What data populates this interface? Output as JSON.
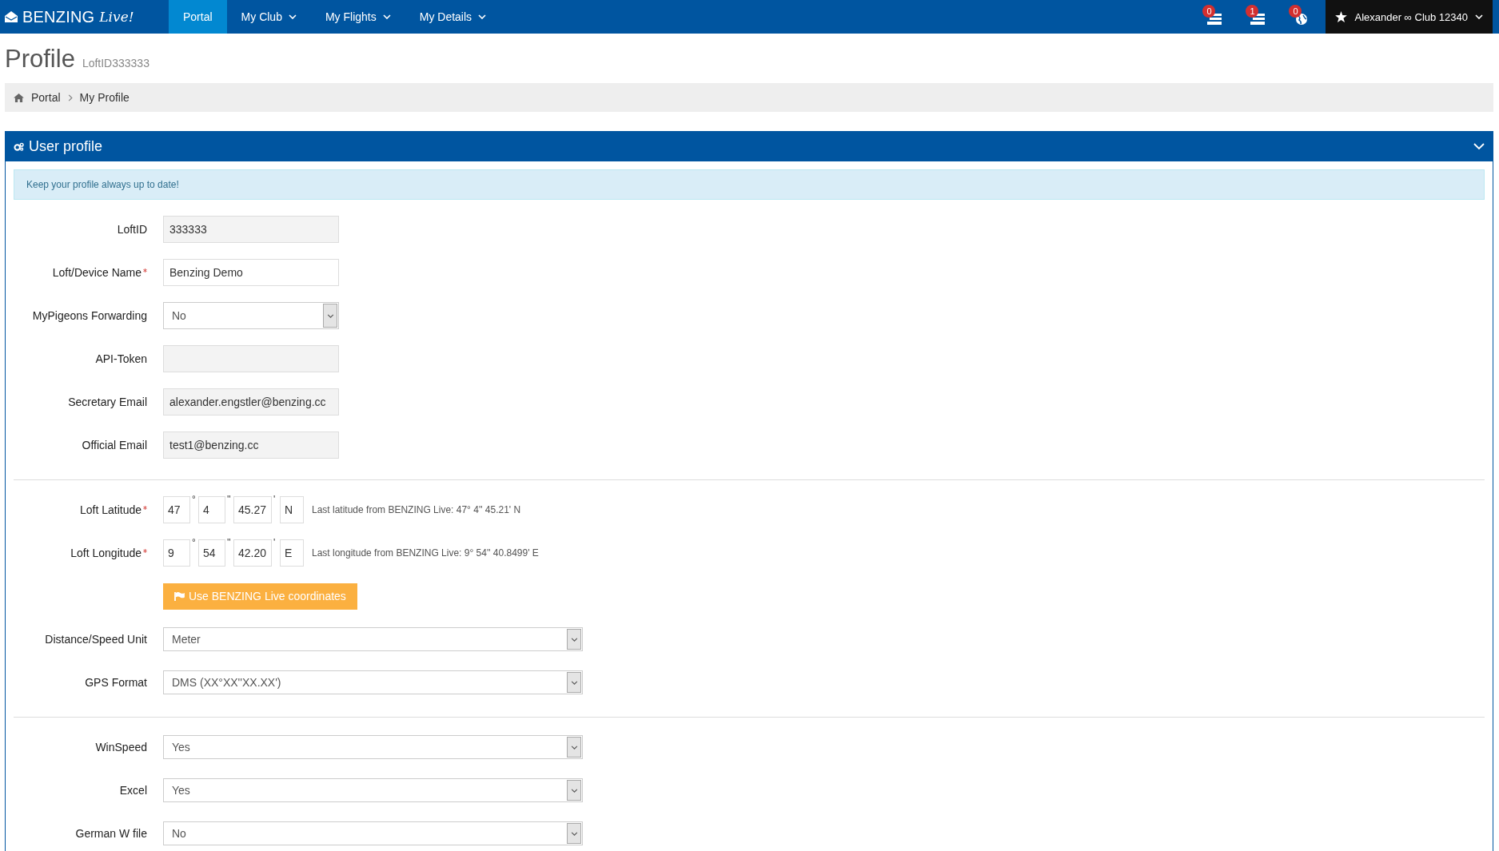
{
  "navbar": {
    "brand": "BENZING",
    "brand_script": "Live!",
    "items": [
      {
        "label": "Portal",
        "selected": true,
        "dropdown": false
      },
      {
        "label": "My Club",
        "selected": false,
        "dropdown": true
      },
      {
        "label": "My Flights",
        "selected": false,
        "dropdown": true
      },
      {
        "label": "My Details",
        "selected": false,
        "dropdown": true
      }
    ],
    "notifications": [
      {
        "kind": "list",
        "count": "0"
      },
      {
        "kind": "list",
        "count": "1"
      },
      {
        "kind": "globe",
        "count": "0"
      }
    ],
    "user": "Alexander ∞ Club 12340"
  },
  "page_title": "Profile",
  "page_subtitle": "LoftID333333",
  "breadcrumb": [
    "Portal",
    "My Profile"
  ],
  "panel": {
    "title": "User profile",
    "expanded": true,
    "alert": "Keep your profile always up to date!",
    "sections": [
      {
        "rows": [
          {
            "kind": "input",
            "label": "LoftID",
            "required": false,
            "readonly": true,
            "value": "333333"
          },
          {
            "kind": "input",
            "label": "Loft/Device Name",
            "required": true,
            "readonly": false,
            "value": "Benzing Demo"
          },
          {
            "kind": "select",
            "label": "MyPigeons Forwarding",
            "required": false,
            "value": "No"
          },
          {
            "kind": "input",
            "label": "API-Token",
            "required": false,
            "readonly": true,
            "value": ""
          },
          {
            "kind": "input",
            "label": "Secretary Email",
            "required": false,
            "readonly": true,
            "value": "alexander.engstler@benzing.cc"
          },
          {
            "kind": "input",
            "label": "Official Email",
            "required": false,
            "readonly": true,
            "value": "test1@benzing.cc"
          }
        ]
      },
      {
        "rows": [
          {
            "kind": "coords",
            "label": "Loft Latitude",
            "required": true,
            "parts": [
              {
                "value": "47",
                "unit": "°"
              },
              {
                "value": "4",
                "unit": "''"
              },
              {
                "value": "45.27",
                "unit": "'"
              }
            ],
            "hemisphere": "N",
            "hint": "Last latitude from BENZING Live: 47° 4'' 45.21' N"
          },
          {
            "kind": "coords",
            "label": "Loft Longitude",
            "required": true,
            "parts": [
              {
                "value": "9",
                "unit": "°"
              },
              {
                "value": "54",
                "unit": "''"
              },
              {
                "value": "42.20",
                "unit": "'"
              }
            ],
            "hemisphere": "E",
            "hint": "Last longitude from BENZING Live: 9° 54'' 40.8499' E"
          },
          {
            "kind": "button",
            "label": "Use BENZING Live coordinates"
          },
          {
            "kind": "wide-select",
            "label": "Distance/Speed Unit",
            "required": false,
            "value": "Meter"
          },
          {
            "kind": "wide-select",
            "label": "GPS Format",
            "required": false,
            "value": "DMS (XX°XX''XX.XX')"
          }
        ]
      },
      {
        "rows": [
          {
            "kind": "wide-select",
            "label": "WinSpeed",
            "required": false,
            "value": "Yes"
          },
          {
            "kind": "wide-select",
            "label": "Excel",
            "required": false,
            "value": "Yes"
          },
          {
            "kind": "wide-select",
            "label": "German W file",
            "required": false,
            "value": "No"
          }
        ]
      }
    ]
  }
}
